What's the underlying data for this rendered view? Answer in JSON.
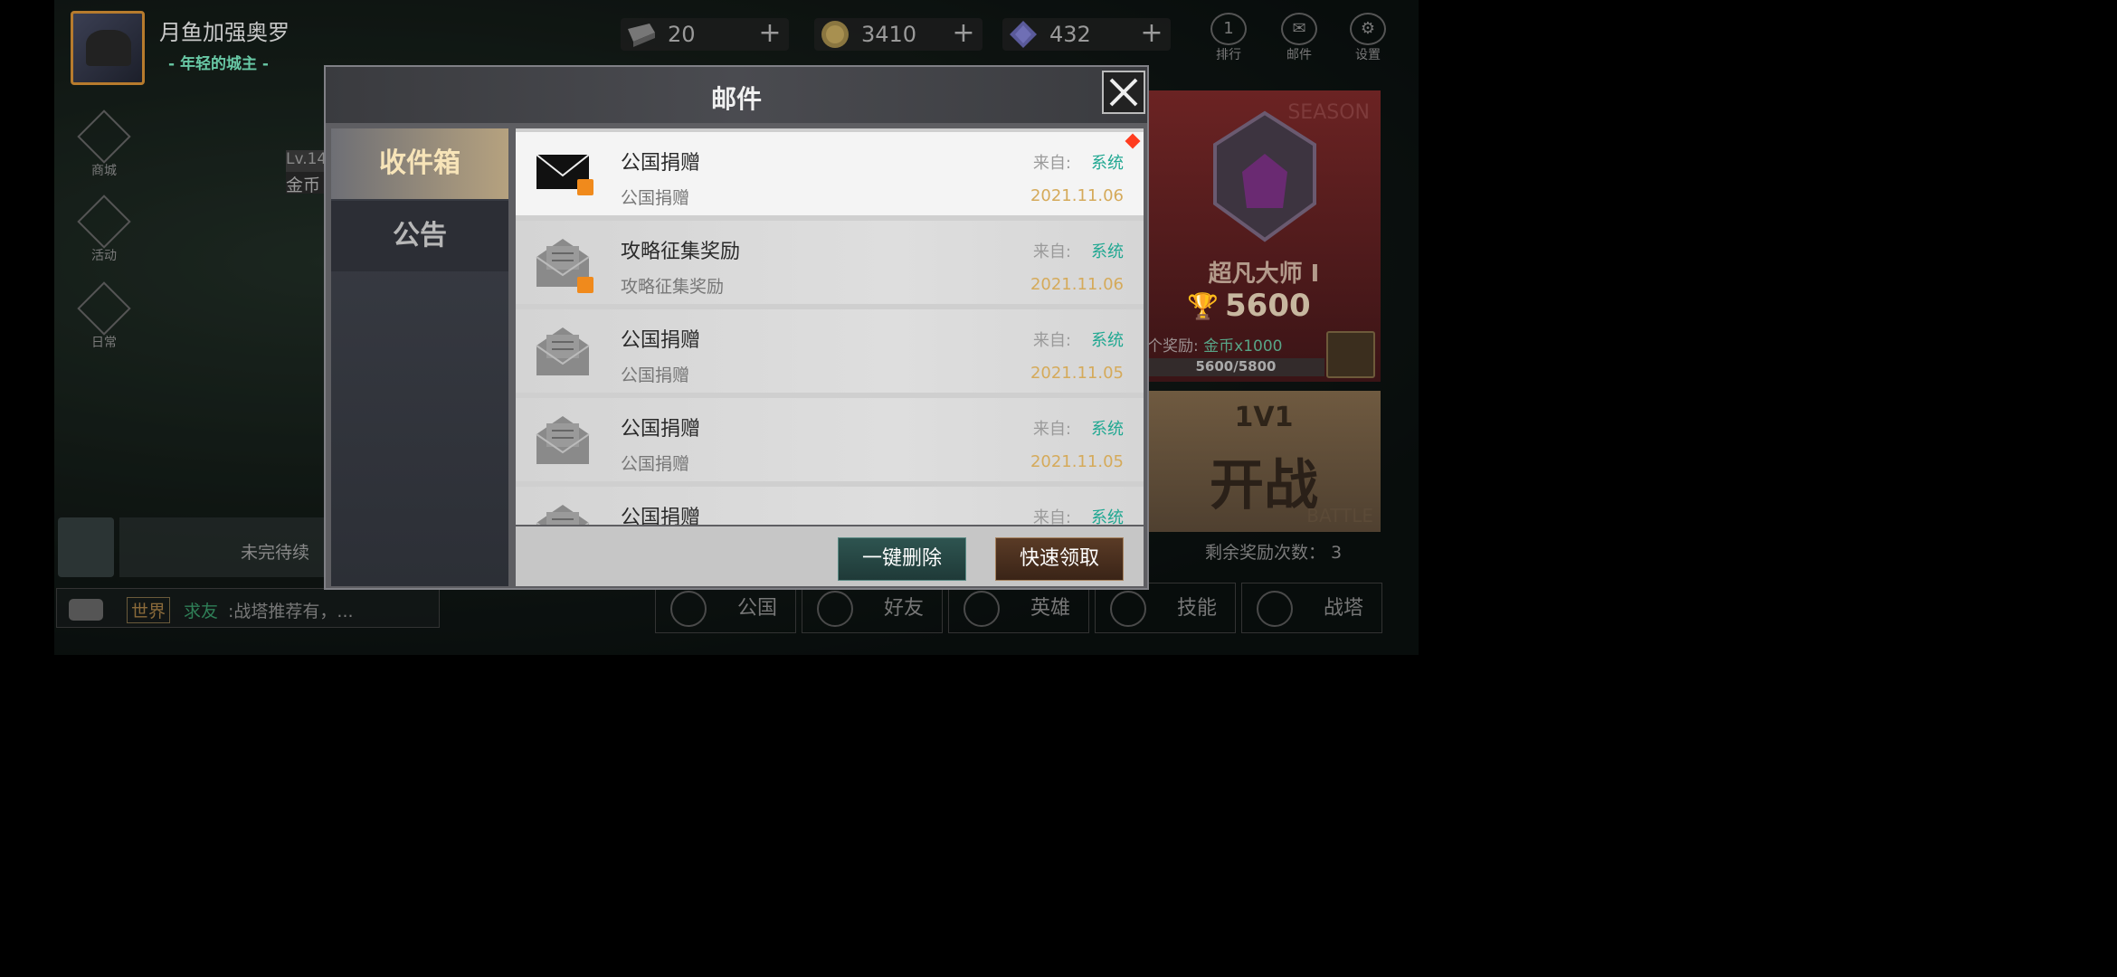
{
  "player": {
    "name": "月鱼加强奥罗",
    "title": "- 年轻的城主 -",
    "level": "Lv.14",
    "gold_label": "金币"
  },
  "resources": [
    {
      "icon": "ingot-icon",
      "value": "20"
    },
    {
      "icon": "gold-coin-icon",
      "value": "3410"
    },
    {
      "icon": "diamond-icon",
      "value": "432"
    }
  ],
  "top_buttons": [
    {
      "icon": "rank-icon",
      "glyph": "1",
      "label": "排行"
    },
    {
      "icon": "mail-icon",
      "glyph": "✉",
      "label": "邮件"
    },
    {
      "icon": "settings-icon",
      "glyph": "⚙",
      "label": "设置"
    }
  ],
  "side_buttons": [
    {
      "icon": "shop-icon",
      "label": "商城"
    },
    {
      "icon": "activity-icon",
      "label": "活动"
    },
    {
      "icon": "daily-icon",
      "label": "日常"
    }
  ],
  "season": {
    "label": "SEASON",
    "rank_name": "超凡大师 Ⅰ",
    "score": "5600",
    "next_reward_prefix": "个奖励: ",
    "next_reward_value": "金币x1000",
    "progress_text": "5600/5800",
    "progress": 0.9655
  },
  "battle": {
    "mode": "1V1",
    "main": "开战",
    "en": "BATTLE"
  },
  "remaining_rewards": "剩余奖励次数：  3",
  "task_text": "未完待续",
  "chat": {
    "channel": "世界",
    "user": "求友",
    "message": ":战塔推荐有，..."
  },
  "nav": [
    "公国",
    "好友",
    "英雄",
    "技能",
    "战塔"
  ],
  "modal": {
    "title": "邮件",
    "tabs": [
      "收件箱",
      "公告"
    ],
    "from_label": "来自:",
    "mails": [
      {
        "title": "公国捐赠",
        "subtitle": "公国捐赠",
        "sender": "系统",
        "date": "2021.11.06",
        "unread": true,
        "attachment": true
      },
      {
        "title": "攻略征集奖励",
        "subtitle": "攻略征集奖励",
        "sender": "系统",
        "date": "2021.11.06",
        "unread": false,
        "attachment": true
      },
      {
        "title": "公国捐赠",
        "subtitle": "公国捐赠",
        "sender": "系统",
        "date": "2021.11.05",
        "unread": false,
        "attachment": false
      },
      {
        "title": "公国捐赠",
        "subtitle": "公国捐赠",
        "sender": "系统",
        "date": "2021.11.05",
        "unread": false,
        "attachment": false
      },
      {
        "title": "公国捐赠",
        "subtitle": "",
        "sender": "系统",
        "date": "",
        "unread": false,
        "attachment": false
      }
    ],
    "delete_all_label": "一键删除",
    "quick_claim_label": "快速领取"
  },
  "colors": {
    "accent_teal": "#21a892",
    "date_gold": "#d5aa5a",
    "new_badge": "#ff3c1f",
    "attachment": "#f08a1c"
  }
}
